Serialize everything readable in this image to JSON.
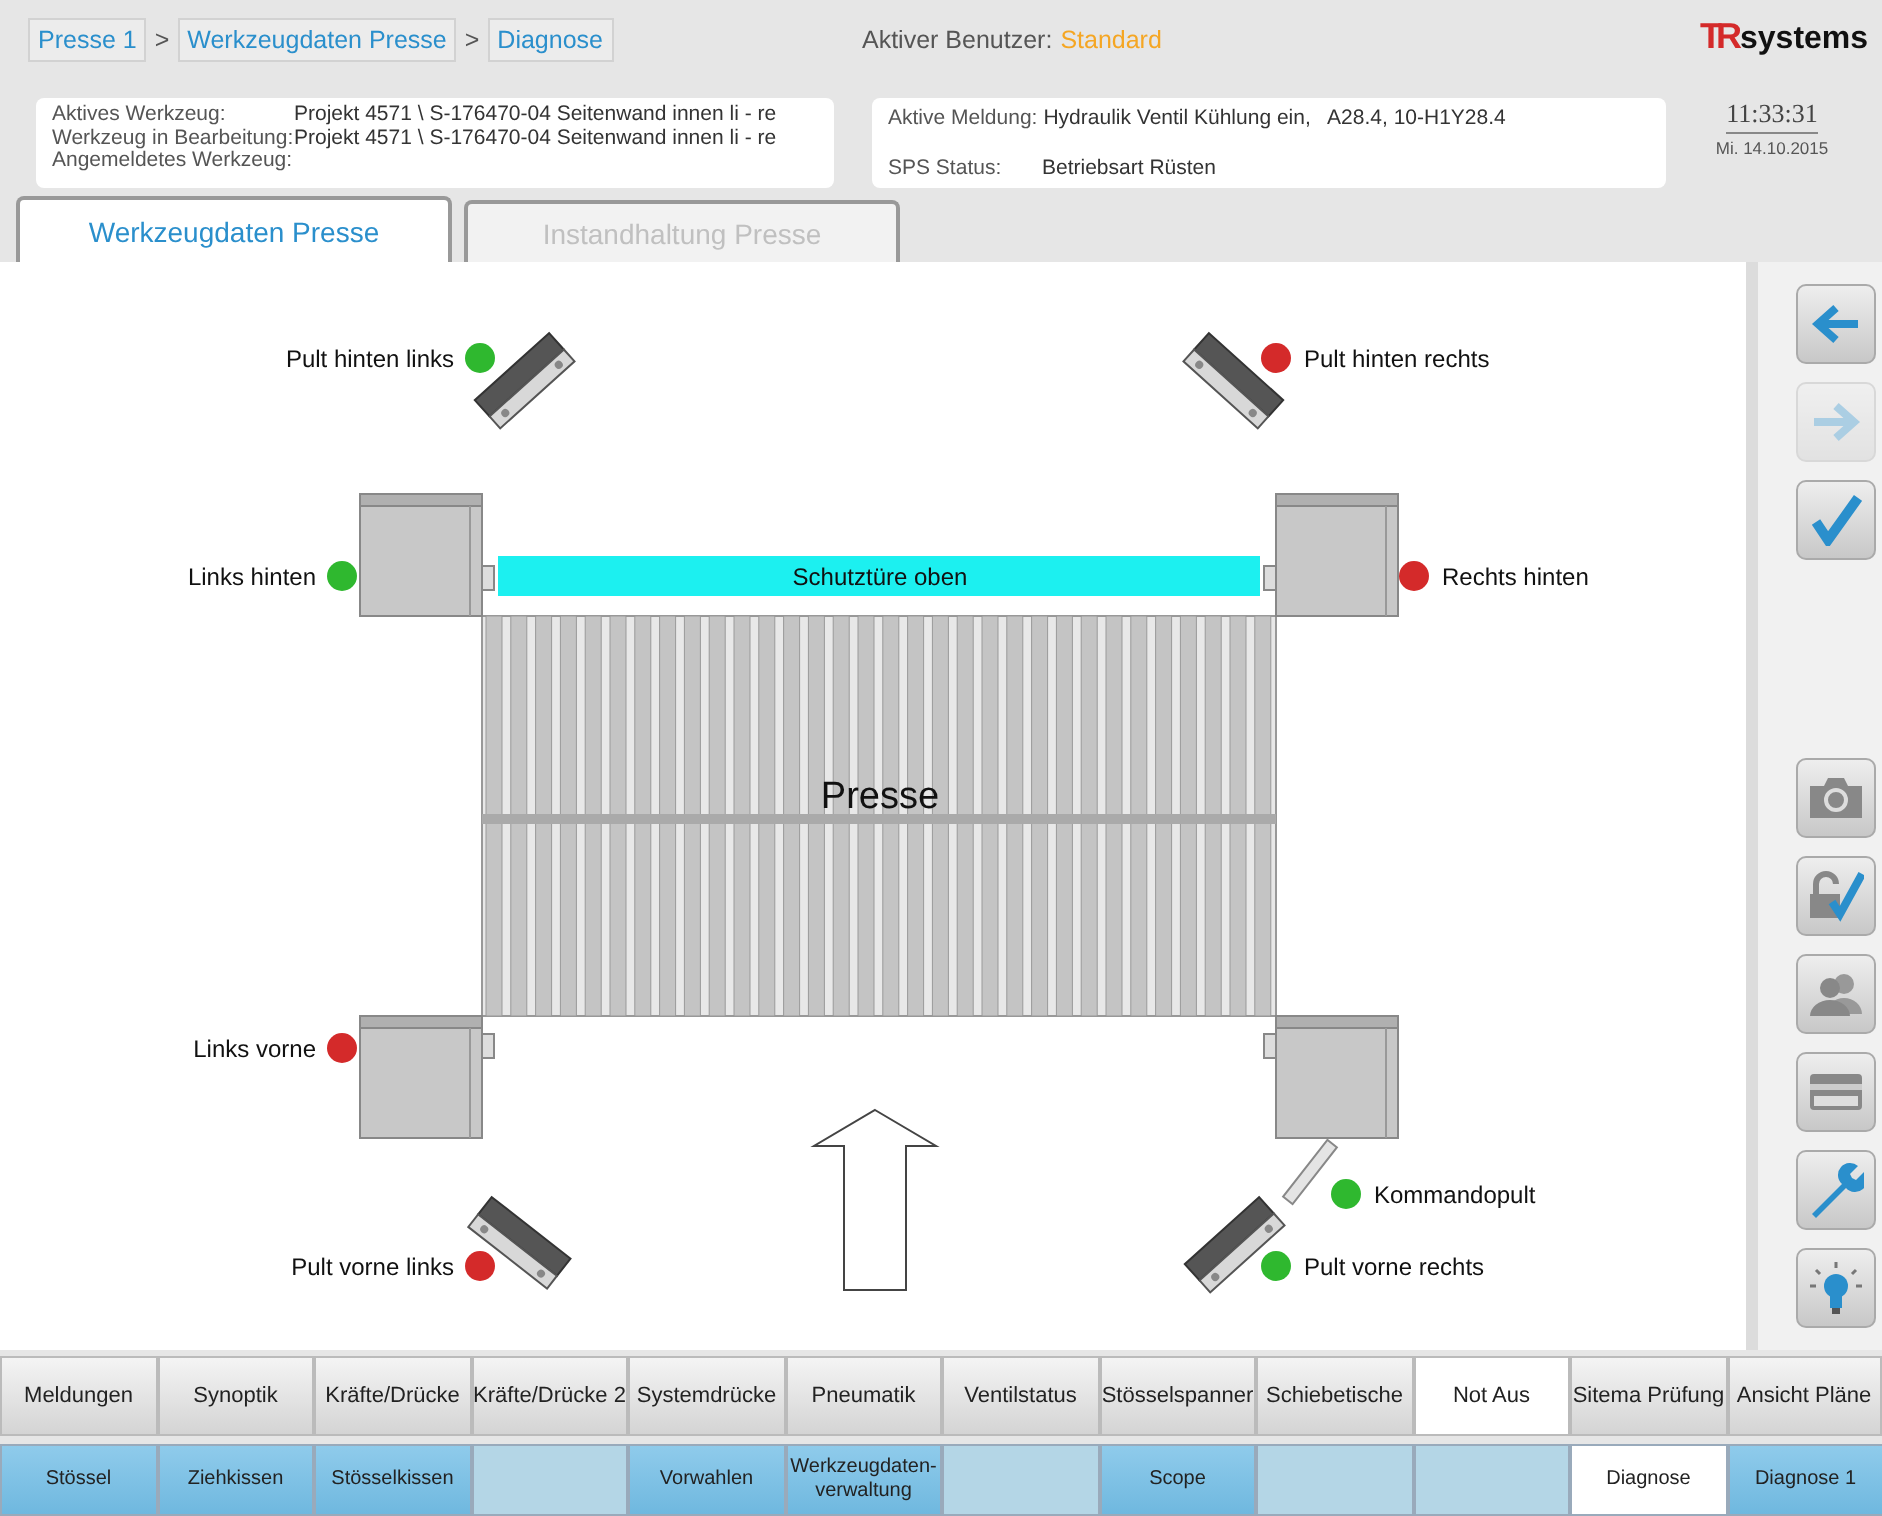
{
  "breadcrumb": {
    "items": [
      "Presse 1",
      "Werkzeugdaten Presse",
      "Diagnose"
    ],
    "separator": ">"
  },
  "user": {
    "label": "Aktiver Benutzer:",
    "value": "Standard"
  },
  "logo": {
    "mark": "TR",
    "text": "systems"
  },
  "tool_info": [
    {
      "label": "Aktives Werkzeug:",
      "value": "Projekt 4571 \\ S-176470-04 Seitenwand innen li - re"
    },
    {
      "label": "Werkzeug in Bearbeitung:",
      "value": "Projekt 4571 \\ S-176470-04 Seitenwand innen li - re"
    },
    {
      "label": "Angemeldetes Werkzeug:"
    }
  ],
  "status_info": [
    {
      "label": "Aktive Meldung:",
      "value": "Hydraulik Ventil Kühlung ein,   A28.4, 10-H1Y28.4"
    },
    {
      "label": "SPS Status:",
      "value": "Betriebsart Rüsten"
    }
  ],
  "clock": {
    "time": "11:33:31",
    "date": "Mi. 14.10.2015"
  },
  "tabs": [
    {
      "label": "Werkzeugdaten Presse",
      "selected": true
    },
    {
      "label": "Instandhaltung Presse",
      "selected": false
    }
  ],
  "diagram": {
    "press_label": "Presse",
    "door_label": "Schutztüre oben",
    "sensors": [
      {
        "label": "Pult hinten links",
        "color": "#2fb82f"
      },
      {
        "label": "Pult hinten rechts",
        "color": "#d42a2a"
      },
      {
        "label": "Links hinten",
        "color": "#2fb82f"
      },
      {
        "label": "Rechts hinten",
        "color": "#d42a2a"
      },
      {
        "label": "Links vorne",
        "color": "#d42a2a"
      },
      {
        "label": "Kommandopult",
        "color": "#2fb82f"
      },
      {
        "label": "Pult vorne links",
        "color": "#d42a2a"
      },
      {
        "label": "Pult vorne rechts",
        "color": "#2fb82f"
      }
    ]
  },
  "side_buttons": [
    {
      "kind": "back",
      "disabled": false
    },
    {
      "kind": "forward",
      "disabled": true
    },
    {
      "kind": "confirm",
      "disabled": false
    },
    {
      "kind": "camera",
      "disabled": false
    },
    {
      "kind": "unlock",
      "disabled": false
    },
    {
      "kind": "users",
      "disabled": false
    },
    {
      "kind": "card",
      "disabled": false
    },
    {
      "kind": "wrench",
      "disabled": false
    },
    {
      "kind": "bulb",
      "disabled": false
    }
  ],
  "nav_top": [
    {
      "label": "Meldungen",
      "selected": false
    },
    {
      "label": "Synoptik",
      "selected": false
    },
    {
      "label": "Kräfte/Drücke",
      "selected": false
    },
    {
      "label": "Kräfte/Drücke 2",
      "selected": false
    },
    {
      "label": "Systemdrücke",
      "selected": false
    },
    {
      "label": "Pneumatik",
      "selected": false
    },
    {
      "label": "Ventilstatus",
      "selected": false
    },
    {
      "label": "Stösselspanner",
      "selected": false
    },
    {
      "label": "Schiebetische",
      "selected": false
    },
    {
      "label": "Not Aus",
      "selected": true
    },
    {
      "label": "Sitema Prüfung",
      "selected": false
    },
    {
      "label": "Ansicht Pläne",
      "selected": false
    }
  ],
  "nav_bottom": [
    {
      "label": "Stössel",
      "selected": false,
      "disabled": false
    },
    {
      "label": "Ziehkissen",
      "selected": false,
      "disabled": false
    },
    {
      "label": "Stösselkissen",
      "selected": false,
      "disabled": false
    },
    {
      "selected": false,
      "disabled": true
    },
    {
      "label": "Vorwahlen",
      "selected": false,
      "disabled": false
    },
    {
      "label": "Werkzeugdaten-verwaltung",
      "selected": false,
      "disabled": false
    },
    {
      "selected": false,
      "disabled": true
    },
    {
      "label": "Scope",
      "selected": false,
      "disabled": false
    },
    {
      "selected": false,
      "disabled": true
    },
    {
      "selected": false,
      "disabled": true
    },
    {
      "label": "Diagnose",
      "selected": true,
      "disabled": false
    },
    {
      "label": "Diagnose 1",
      "selected": false,
      "disabled": false
    }
  ]
}
